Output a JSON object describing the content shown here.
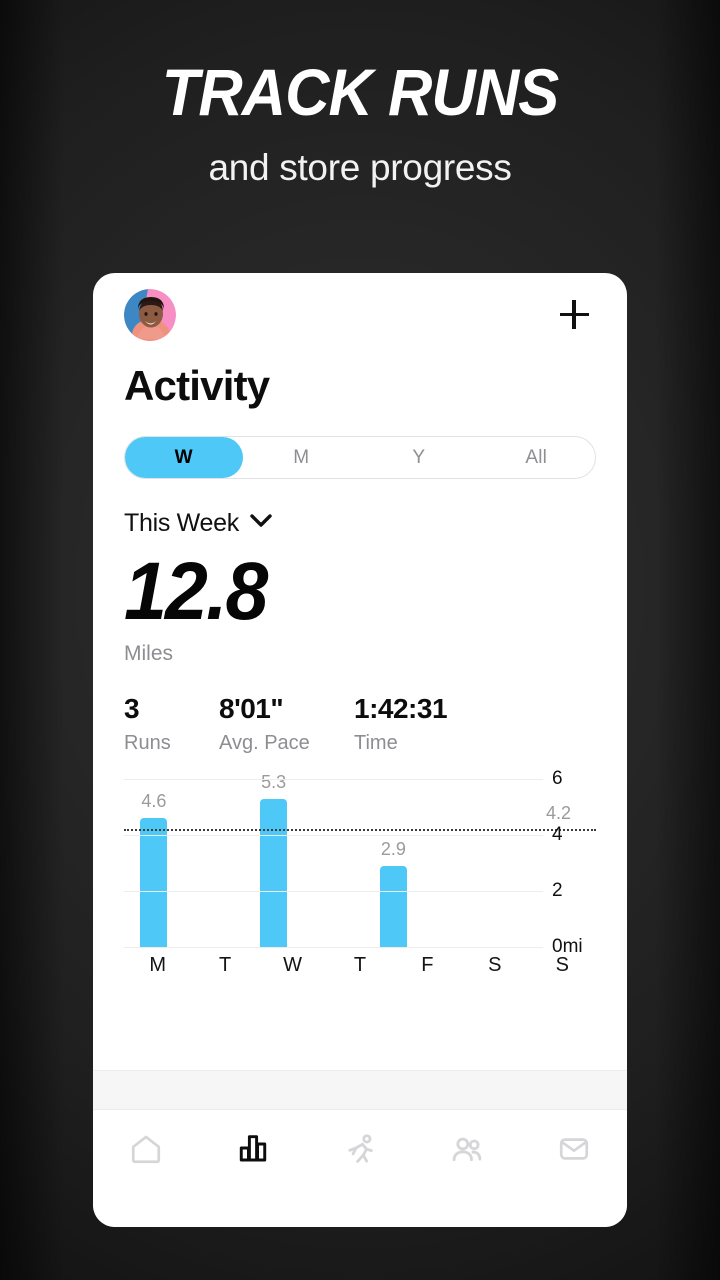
{
  "hero": {
    "headline": "TRACK RUNS",
    "subhead": "and store progress"
  },
  "card": {
    "topbar": {
      "avatar_name": "user-avatar",
      "add_label": "+"
    },
    "page_title": "Activity",
    "segmented": {
      "options": [
        {
          "label": "W",
          "active": true
        },
        {
          "label": "M",
          "active": false
        },
        {
          "label": "Y",
          "active": false
        },
        {
          "label": "All",
          "active": false
        }
      ]
    },
    "period": {
      "label": "This Week",
      "chevron": "chevron-down-icon"
    },
    "summary": {
      "value": "12.8",
      "unit": "Miles"
    },
    "stats": [
      {
        "value": "3",
        "label": "Runs"
      },
      {
        "value": "8'01\"",
        "label": "Avg. Pace"
      },
      {
        "value": "1:42:31",
        "label": "Time"
      }
    ],
    "nav": [
      {
        "name": "home",
        "active": false
      },
      {
        "name": "stats",
        "active": true
      },
      {
        "name": "run",
        "active": false
      },
      {
        "name": "friends",
        "active": false
      },
      {
        "name": "inbox",
        "active": false
      }
    ]
  },
  "chart_data": {
    "type": "bar",
    "title": "",
    "xlabel": "",
    "ylabel": "mi",
    "categories": [
      "M",
      "T",
      "W",
      "T",
      "F",
      "S",
      "S"
    ],
    "values": [
      4.6,
      null,
      5.3,
      null,
      2.9,
      null,
      null
    ],
    "bar_labels": [
      "4.6",
      "",
      "5.3",
      "",
      "2.9",
      "",
      ""
    ],
    "ylim": [
      0,
      6
    ],
    "yticks": [
      0,
      2,
      4,
      6
    ],
    "ytick_labels": [
      "0mi",
      "2",
      "4",
      "6"
    ],
    "grid": true,
    "legend": "none",
    "average_line": {
      "value": 4.2,
      "label": "4.2",
      "style": "dotted"
    },
    "bar_color": "#4dc8f7",
    "label_color": "#9b9b9b"
  },
  "colors": {
    "accent": "#4dc8f7",
    "card_bg": "#ffffff",
    "page_bg": "#242424",
    "text_primary": "#0d0d0d",
    "text_muted": "#8d8d92"
  }
}
